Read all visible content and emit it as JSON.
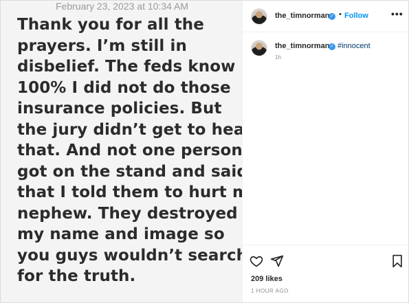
{
  "post_image": {
    "timestamp": "February 23, 2023 at 10:34 AM",
    "lines": [
      "Thank you for all the",
      "prayers. I’m still in",
      "disbelief. The feds know",
      "100% I did not do those",
      "insurance policies. But",
      "the jury didn’t get to hear",
      "that. And not one person",
      "got on the stand and said",
      "that I told them to hurt my",
      "nephew. They destroyed",
      "my name and image so",
      "you guys wouldn’t search",
      "for the truth."
    ]
  },
  "header": {
    "username": "the_timnorman",
    "separator": "•",
    "follow_label": "Follow",
    "more_label": "•••"
  },
  "caption": {
    "username": "the_timnorman",
    "hashtag": "#innocent",
    "time": "1h"
  },
  "actions": {
    "likes": "209 likes",
    "post_age": "1 HOUR AGO"
  },
  "icons": {
    "verified": "verified-badge-icon",
    "like": "heart-icon",
    "share": "paper-plane-icon",
    "save": "bookmark-icon"
  },
  "colors": {
    "verified_blue": "#3897f0",
    "follow_blue": "#0095f6",
    "hashtag_blue": "#00376b",
    "muted_gray": "#8e8e8e"
  }
}
